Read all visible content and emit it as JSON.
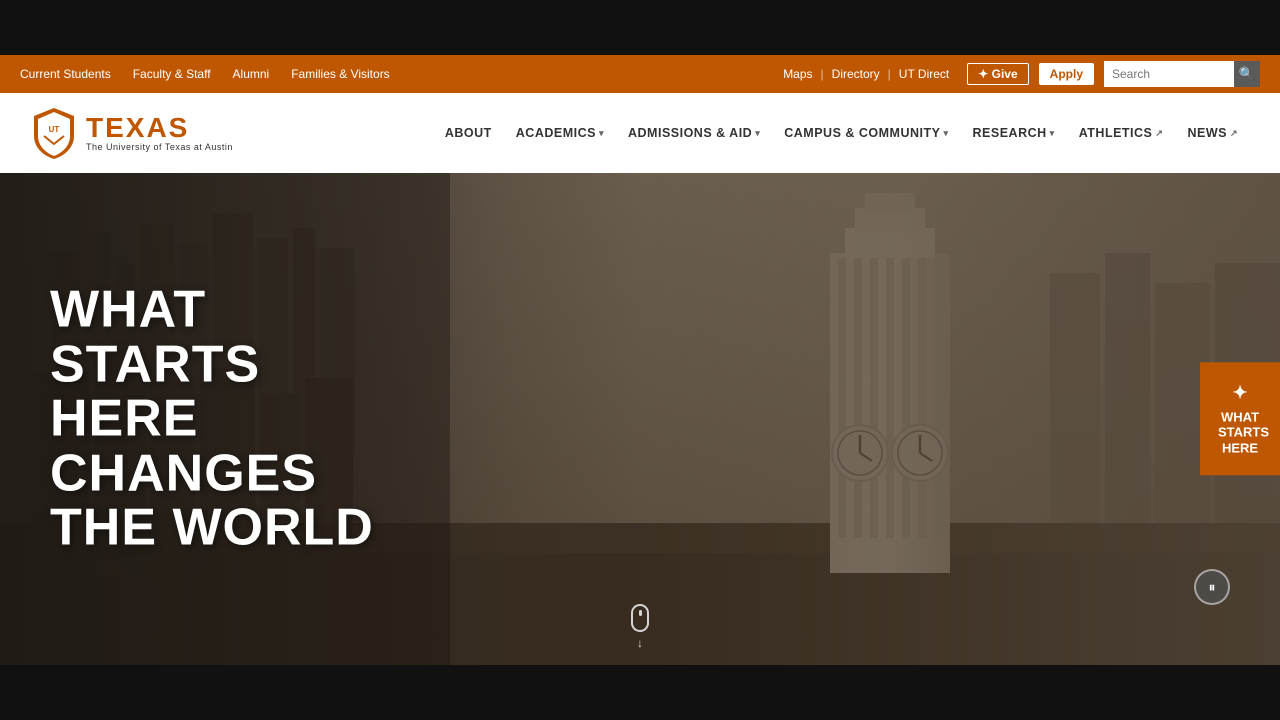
{
  "utility_bar": {
    "left_links": [
      {
        "label": "Current Students",
        "id": "current-students"
      },
      {
        "label": "Faculty & Staff",
        "id": "faculty-staff"
      },
      {
        "label": "Alumni",
        "id": "alumni"
      },
      {
        "label": "Families & Visitors",
        "id": "families-visitors"
      }
    ],
    "right_links": [
      {
        "label": "Maps",
        "id": "maps"
      },
      {
        "label": "Directory",
        "id": "directory"
      },
      {
        "label": "UT Direct",
        "id": "ut-direct"
      }
    ],
    "give_label": "✦ Give",
    "apply_label": "Apply",
    "search_placeholder": "Search"
  },
  "logo": {
    "texas_label": "TEXAS",
    "subtitle": "The University of Texas at Austin"
  },
  "nav": {
    "items": [
      {
        "label": "ABOUT",
        "has_dropdown": false,
        "external": false
      },
      {
        "label": "ACADEMICS",
        "has_dropdown": true,
        "external": false
      },
      {
        "label": "ADMISSIONS & AID",
        "has_dropdown": true,
        "external": false
      },
      {
        "label": "CAMPUS & COMMUNITY",
        "has_dropdown": true,
        "external": false
      },
      {
        "label": "RESEARCH",
        "has_dropdown": true,
        "external": false
      },
      {
        "label": "ATHLETICS",
        "has_dropdown": false,
        "external": true
      },
      {
        "label": "NEWS",
        "has_dropdown": false,
        "external": true
      }
    ]
  },
  "hero": {
    "headline_line1": "WHAT",
    "headline_line2": "STARTS",
    "headline_line3": "HERE",
    "headline_line4": "CHANGES",
    "headline_line5": "THE WORLD",
    "side_widget_line1": "WHAT",
    "side_widget_line2": "STARTS",
    "side_widget_line3": "HERE",
    "pause_icon": "⏸",
    "scroll_arrow": "↓"
  },
  "colors": {
    "ut_orange": "#bf5700",
    "white": "#ffffff",
    "dark": "#333333"
  }
}
